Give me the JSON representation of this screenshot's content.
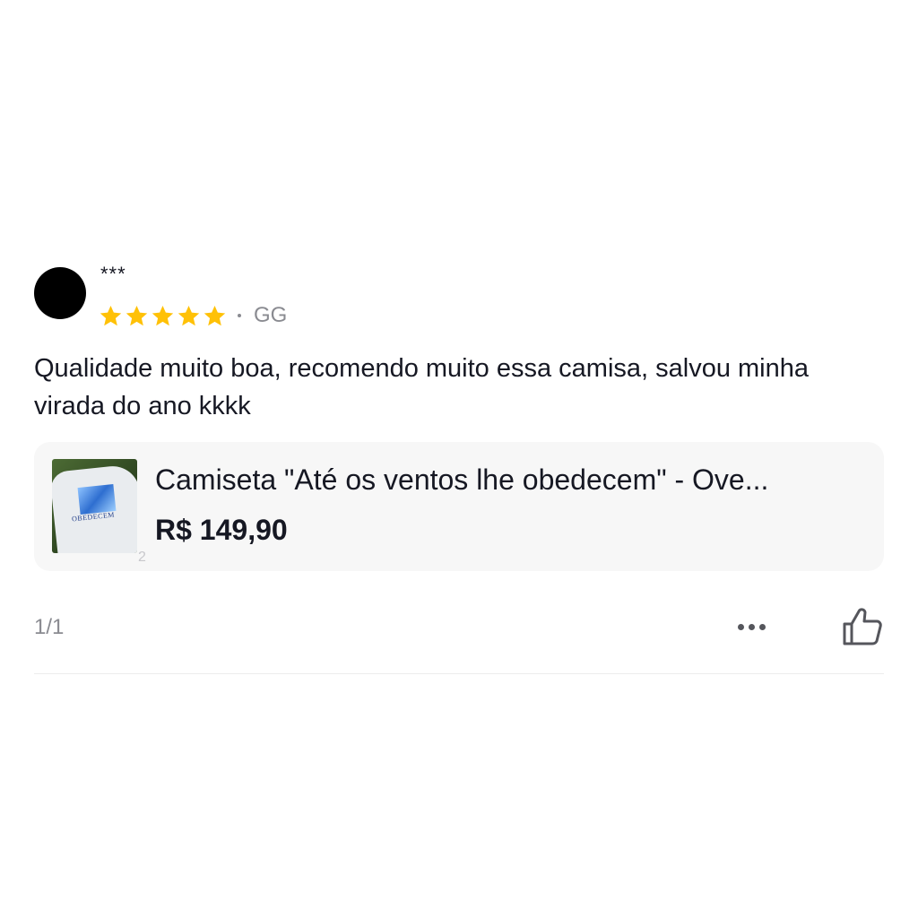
{
  "review": {
    "reviewer_name": "***",
    "rating": 5,
    "rating_max": 5,
    "variant": "GG",
    "text": "Qualidade muito boa, recomendo muito essa camisa, salvou minha virada do ano kkkk",
    "star_color": "#FFC107"
  },
  "product": {
    "title": "Camiseta \"Até os ventos lhe obedecem\" - Ove...",
    "price": "R$ 149,90",
    "thumbnail_text": "OBEDECEM",
    "image_count": "2"
  },
  "footer": {
    "image_counter": "1/1",
    "more_icon": "more-dots-icon",
    "like_icon": "thumbs-up-icon"
  }
}
